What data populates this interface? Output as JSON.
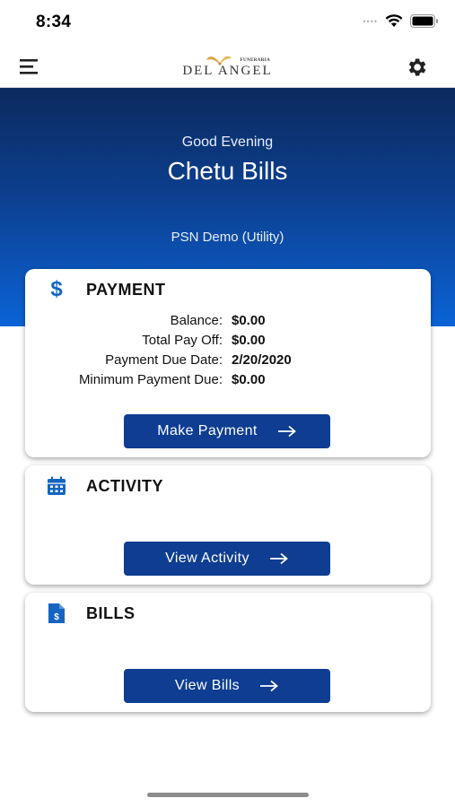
{
  "status_bar": {
    "time": "8:34",
    "signal_dots": "••••"
  },
  "nav": {
    "brand_small": "FUNERARIA",
    "brand_name": "DEL ANGEL"
  },
  "header": {
    "greeting": "Good Evening",
    "user_name": "Chetu Bills",
    "account": "PSN Demo (Utility)"
  },
  "payment_card": {
    "title": "PAYMENT",
    "icon": "dollar-icon",
    "rows": [
      {
        "label": "Balance:",
        "value": "$0.00"
      },
      {
        "label": "Total Pay Off:",
        "value": "$0.00"
      },
      {
        "label": "Payment Due Date:",
        "value": "2/20/2020"
      },
      {
        "label": "Minimum Payment Due:",
        "value": "$0.00"
      }
    ],
    "button_label": "Make Payment"
  },
  "activity_card": {
    "title": "ACTIVITY",
    "icon": "calendar-icon",
    "button_label": "View Activity"
  },
  "bills_card": {
    "title": "BILLS",
    "icon": "bill-document-icon",
    "button_label": "View Bills"
  },
  "colors": {
    "primary_button": "#0e3d91",
    "header_top": "#0c2a5e",
    "header_bottom": "#0b63d6",
    "icon_blue": "#1565c0",
    "brand_gold": "#d9a441"
  }
}
